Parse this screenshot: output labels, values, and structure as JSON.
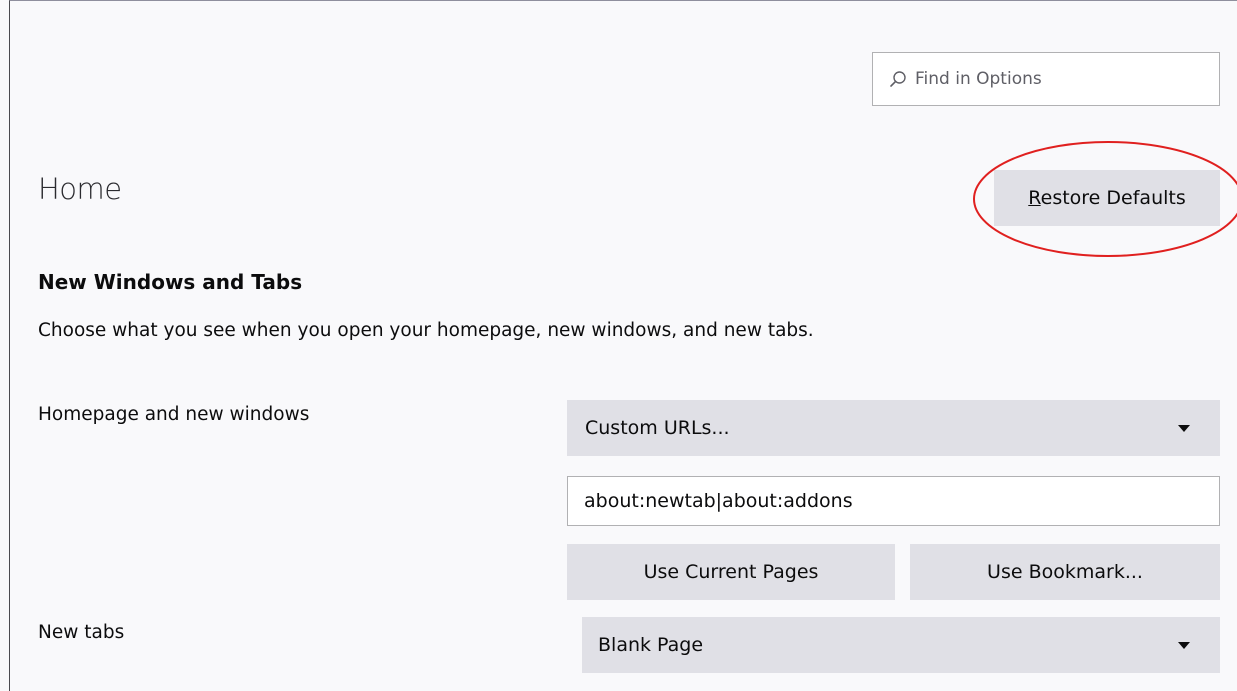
{
  "search": {
    "placeholder": "Find in Options",
    "icon": "search-icon"
  },
  "header": {
    "title": "Home",
    "restore_accel": "R",
    "restore_rest": "estore Defaults"
  },
  "section": {
    "title": "New Windows and Tabs",
    "description": "Choose what you see when you open your homepage, new windows, and new tabs."
  },
  "homepage": {
    "label": "Homepage and new windows",
    "selected": "Custom URLs...",
    "url_value": "about:newtab|about:addons",
    "use_current_label": "Use Current Pages",
    "use_bookmark_label": "Use Bookmark..."
  },
  "newtabs": {
    "label": "New tabs",
    "selected": "Blank Page"
  },
  "colors": {
    "annotation": "#e0201f",
    "button_bg": "#e0e0e6",
    "page_bg": "#f9f9fb"
  }
}
